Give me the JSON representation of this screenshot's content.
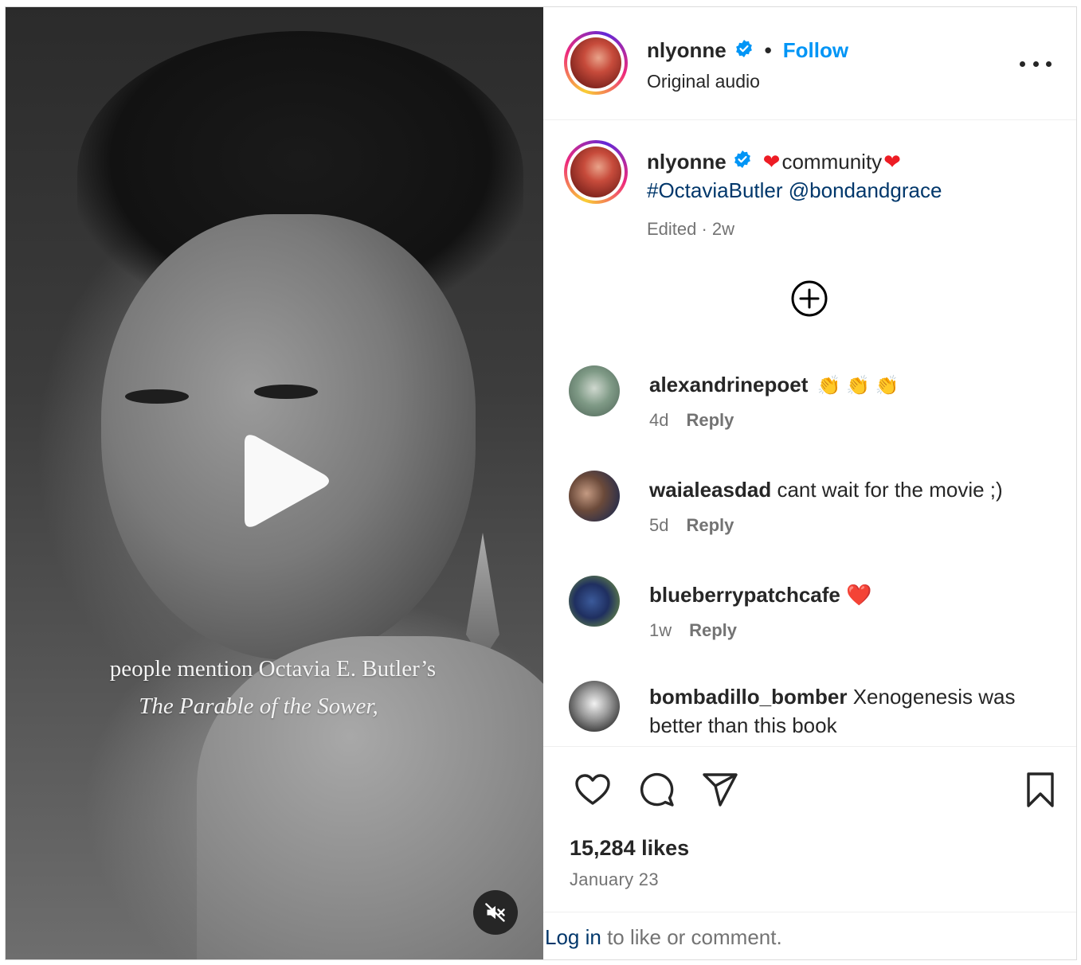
{
  "video": {
    "overlay_line1": "people mention Octavia E. Butler’s",
    "overlay_line2": "The Parable of the Sower,"
  },
  "header": {
    "username": "nlyonne",
    "separator": "•",
    "follow_label": "Follow",
    "audio_label": "Original audio"
  },
  "caption": {
    "username": "nlyonne",
    "heart": "❤",
    "text": "community",
    "hashtag": "#OctaviaButler",
    "mention": "@bondandgrace",
    "meta": "Edited · 2w"
  },
  "comments": [
    {
      "user": "alexandrinepoet",
      "text": "",
      "emoji": "👏 👏 👏",
      "time": "4d",
      "reply": "Reply"
    },
    {
      "user": "waialeasdad",
      "text": "cant wait for the movie ;)",
      "emoji": "",
      "time": "5d",
      "reply": "Reply"
    },
    {
      "user": "blueberrypatchcafe",
      "text": "",
      "emoji": "❤️",
      "time": "1w",
      "reply": "Reply"
    },
    {
      "user": "bombadillo_bomber",
      "text": "Xenogenesis was better than this book",
      "emoji": "",
      "time": "",
      "reply": ""
    }
  ],
  "stats": {
    "likes": "15,284 likes",
    "date": "January 23"
  },
  "login": {
    "link": "Log in",
    "rest": " to like or comment."
  },
  "colors": {
    "accent": "#0095f6",
    "link": "#00376b",
    "muted": "#737373",
    "heart": "#ed1c24"
  }
}
